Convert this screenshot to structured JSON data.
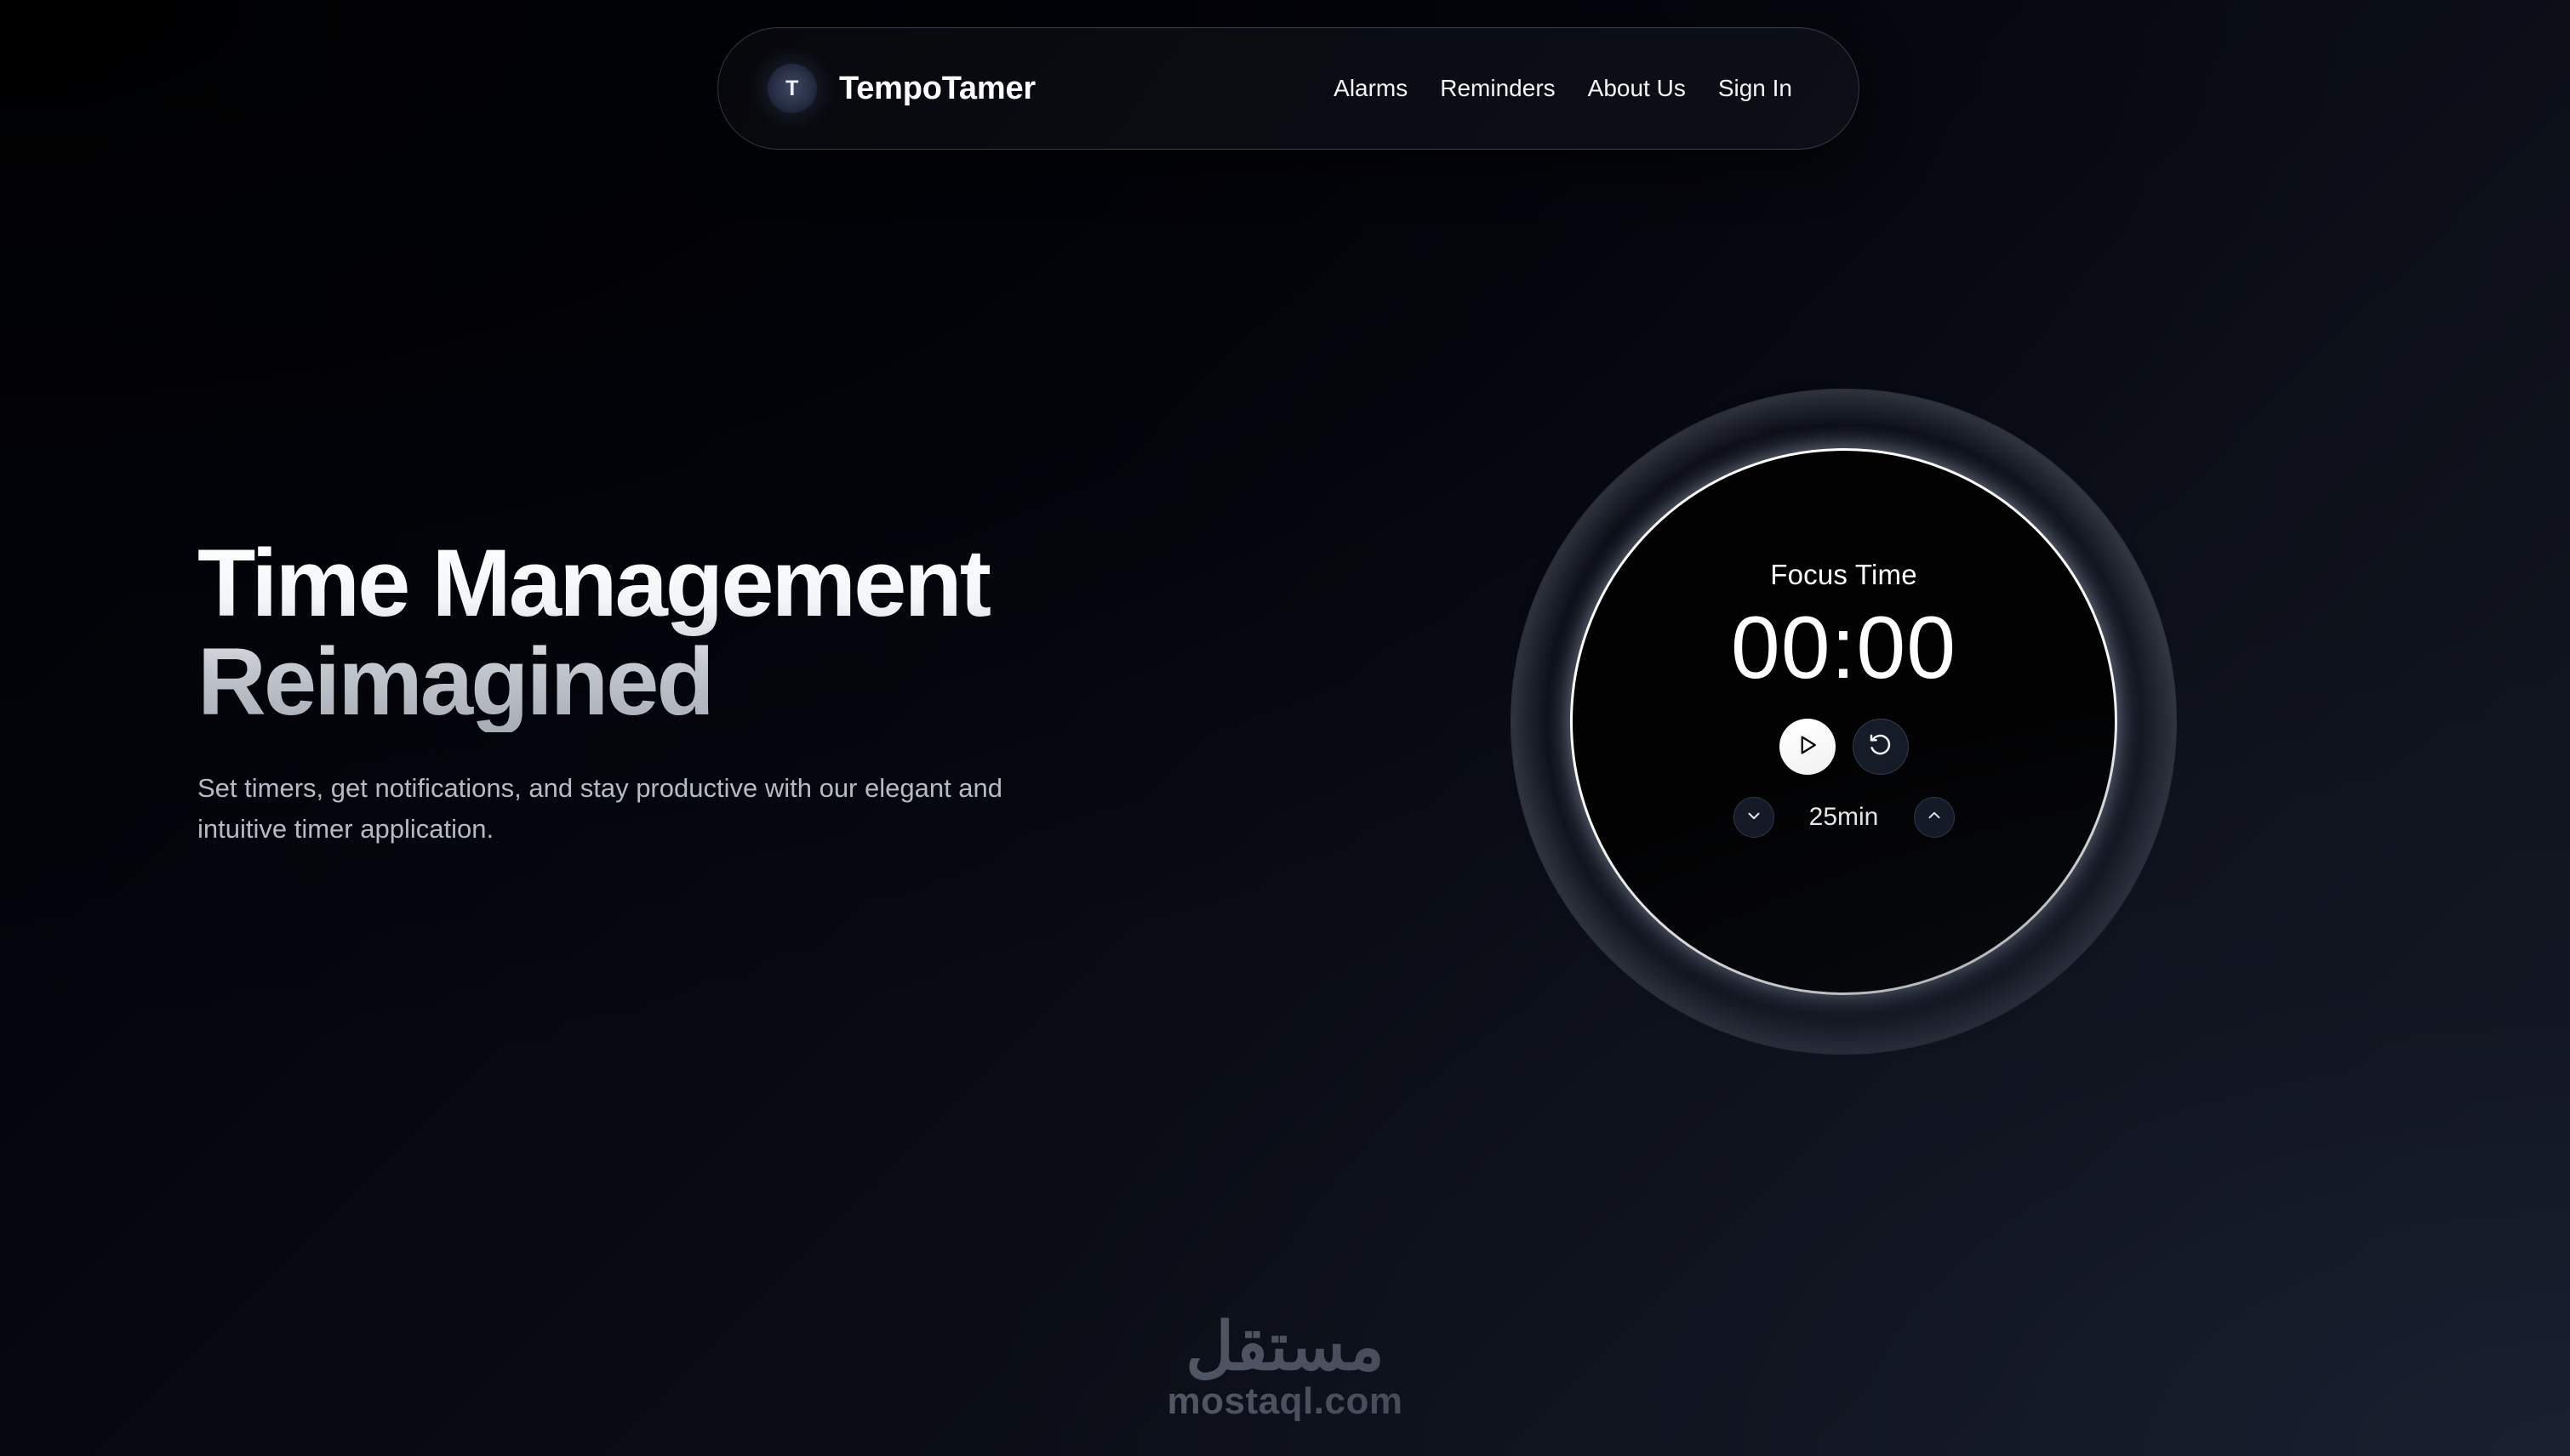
{
  "brand": {
    "name": "TempoTamer",
    "logo_letter": "T",
    "logo_icon": "t-monogram-icon"
  },
  "nav": {
    "links": [
      {
        "label": "Alarms"
      },
      {
        "label": "Reminders"
      },
      {
        "label": "About Us"
      },
      {
        "label": "Sign In"
      }
    ]
  },
  "hero": {
    "headline": "Time Management\nReimagined",
    "subcopy": "Set timers, get notifications, and stay productive with our elegant and\nintuitive timer application."
  },
  "timer": {
    "mode_label": "Focus Time",
    "display": "00:00",
    "duration": "25min",
    "play_icon": "play-icon",
    "reset_icon": "rotate-ccw-icon",
    "decrease_icon": "chevron-down-icon",
    "increase_icon": "chevron-up-icon"
  },
  "watermark": {
    "arabic": "مستقل",
    "latin": "mostaql.com"
  },
  "colors": {
    "page_bg_start": "#010103",
    "page_bg_end": "#131823",
    "dial_bg": "#010101",
    "dial_ring": "#ffffff",
    "text_primary": "#ffffff",
    "text_muted": "#b5bac4",
    "watermark": "#585e6b"
  }
}
